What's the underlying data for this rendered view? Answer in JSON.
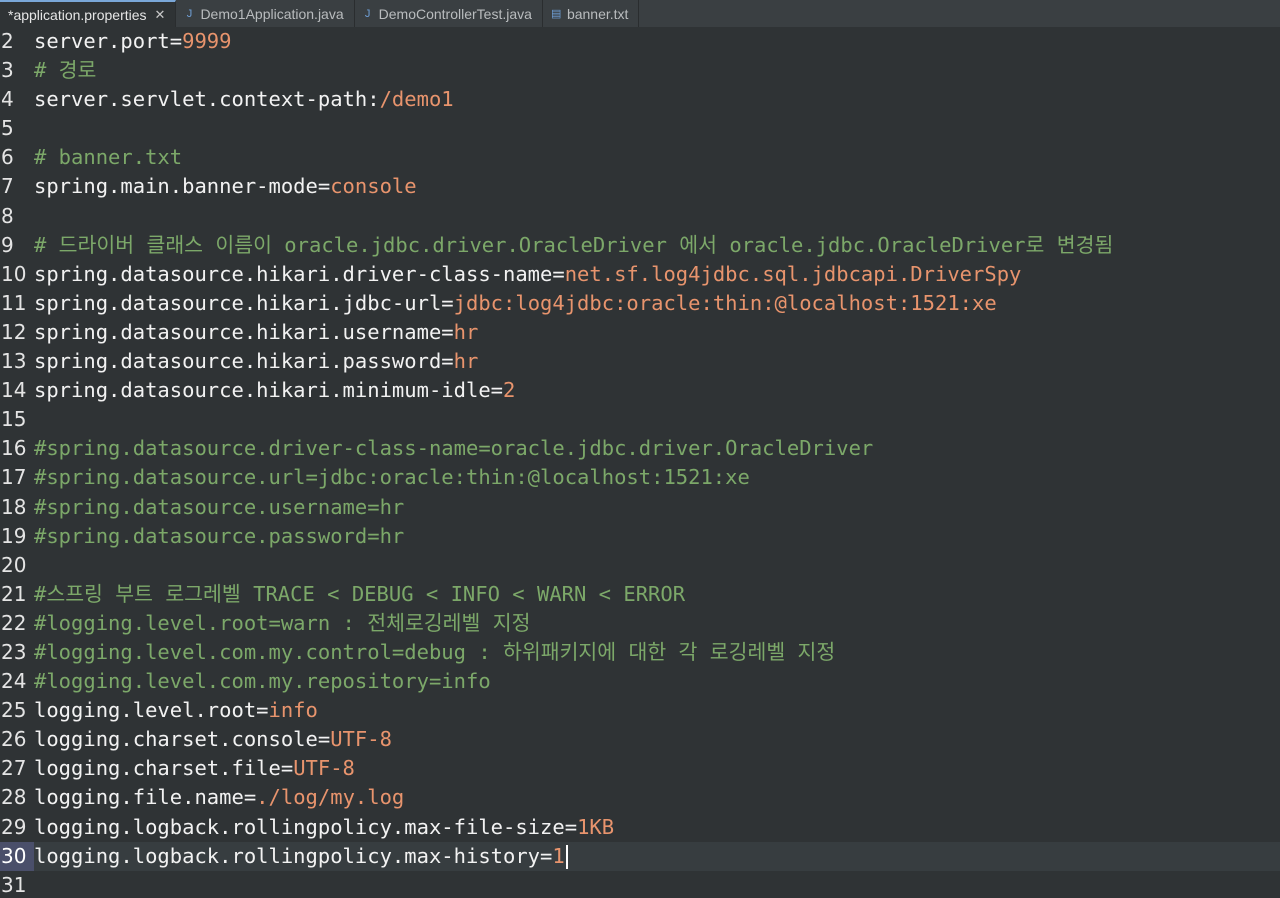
{
  "tabs": [
    {
      "label": "*application.properties",
      "icon": "properties-file-icon",
      "active": true,
      "closable": true
    },
    {
      "label": "Demo1Application.java",
      "icon": "java-file-icon",
      "active": false,
      "closable": false
    },
    {
      "label": "DemoControllerTest.java",
      "icon": "java-file-icon",
      "active": false,
      "closable": false
    },
    {
      "label": "banner.txt",
      "icon": "text-file-icon",
      "active": false,
      "closable": false
    }
  ],
  "close_glyph": "✕",
  "current_line": "30",
  "lines": [
    {
      "num": "2",
      "key": "server.port=",
      "val": "9999"
    },
    {
      "num": "3",
      "cmt": "# 경로"
    },
    {
      "num": "4",
      "key": "server.servlet.context-path:",
      "val": "/demo1"
    },
    {
      "num": "5"
    },
    {
      "num": "6",
      "cmt": "# banner.txt"
    },
    {
      "num": "7",
      "key": "spring.main.banner-mode=",
      "val": "console"
    },
    {
      "num": "8"
    },
    {
      "num": "9",
      "cmt": "# 드라이버 클래스 이름이 oracle.jdbc.driver.OracleDriver 에서 oracle.jdbc.OracleDriver로 변경됨"
    },
    {
      "num": "10",
      "key": "spring.datasource.hikari.driver-class-name=",
      "val": "net.sf.log4jdbc.sql.jdbcapi.DriverSpy"
    },
    {
      "num": "11",
      "key": "spring.datasource.hikari.jdbc-url=",
      "val": "jdbc:log4jdbc:oracle:thin:@localhost:1521:xe"
    },
    {
      "num": "12",
      "key": "spring.datasource.hikari.username=",
      "val": "hr"
    },
    {
      "num": "13",
      "key": "spring.datasource.hikari.password=",
      "val": "hr"
    },
    {
      "num": "14",
      "key": "spring.datasource.hikari.minimum-idle=",
      "val": "2"
    },
    {
      "num": "15"
    },
    {
      "num": "16",
      "cmt": "#spring.datasource.driver-class-name=oracle.jdbc.driver.OracleDriver"
    },
    {
      "num": "17",
      "cmt": "#spring.datasource.url=jdbc:oracle:thin:@localhost:1521:xe"
    },
    {
      "num": "18",
      "cmt": "#spring.datasource.username=hr"
    },
    {
      "num": "19",
      "cmt": "#spring.datasource.password=hr"
    },
    {
      "num": "20"
    },
    {
      "num": "21",
      "cmt": "#스프링 부트 로그레벨 TRACE < DEBUG < INFO < WARN < ERROR"
    },
    {
      "num": "22",
      "cmt": "#logging.level.root=warn : 전체로깅레벨 지정"
    },
    {
      "num": "23",
      "cmt": "#logging.level.com.my.control=debug : 하위패키지에 대한 각 로깅레벨 지정"
    },
    {
      "num": "24",
      "cmt": "#logging.level.com.my.repository=info"
    },
    {
      "num": "25",
      "key": "logging.level.root=",
      "val": "info"
    },
    {
      "num": "26",
      "key": "logging.charset.console=",
      "val": "UTF-8"
    },
    {
      "num": "27",
      "key": "logging.charset.file=",
      "val": "UTF-8"
    },
    {
      "num": "28",
      "key": "logging.file.name=",
      "val": "./log/my.log"
    },
    {
      "num": "29",
      "key": "logging.logback.rollingpolicy.max-file-size=",
      "val": "1KB"
    },
    {
      "num": "30",
      "key": "logging.logback.rollingpolicy.max-history=",
      "val": "1"
    },
    {
      "num": "31"
    }
  ],
  "colors": {
    "background": "#2f3335",
    "key": "#f2f2f2",
    "value": "#e8946d",
    "comment": "#7ca869",
    "current_line_number_bg": "#4a4f6a"
  }
}
